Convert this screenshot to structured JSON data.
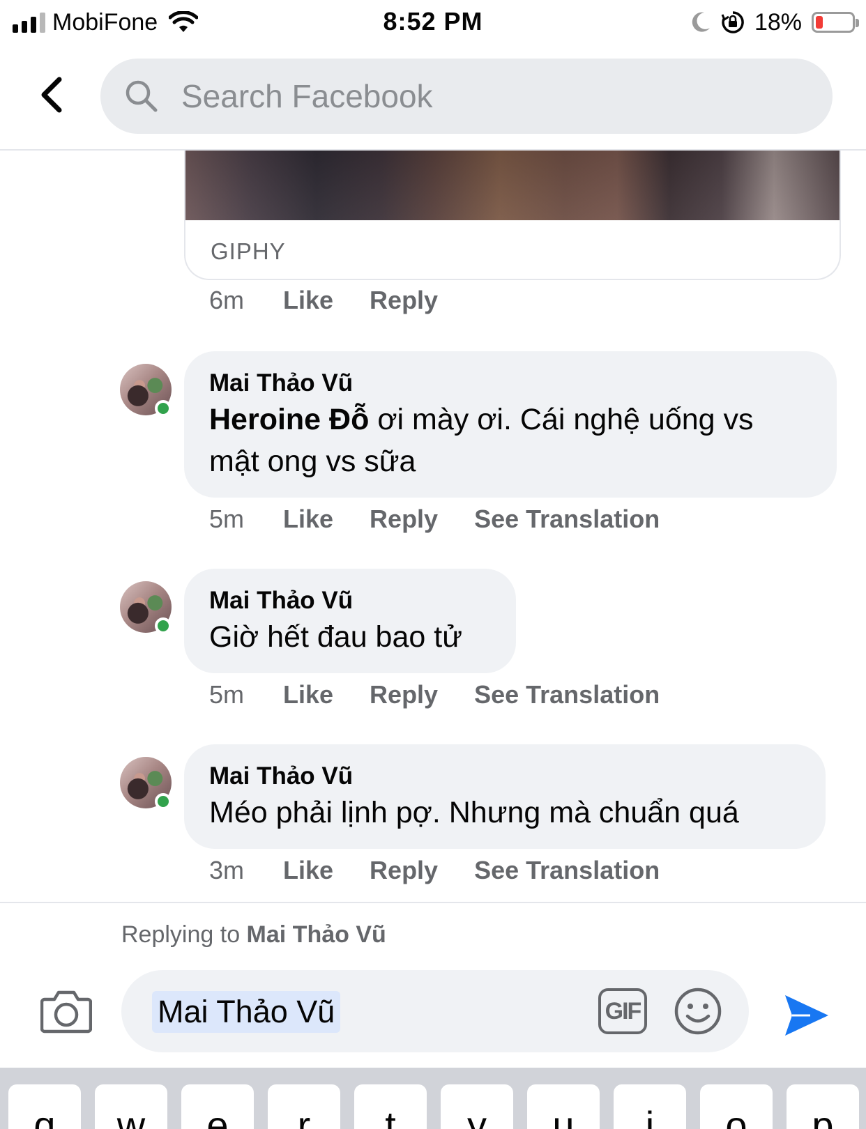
{
  "status_bar": {
    "carrier": "MobiFone",
    "time": "8:52 PM",
    "battery_percent": "18%",
    "battery_level": 0.18,
    "icons": [
      "signal-icon",
      "wifi-icon",
      "moon-icon",
      "orientation-lock-icon",
      "battery-icon"
    ]
  },
  "header": {
    "back_icon": "chevron-left-icon",
    "search_placeholder": "Search Facebook"
  },
  "gif_attachment": {
    "source": "GIPHY",
    "meta": {
      "time": "6m",
      "like": "Like",
      "reply": "Reply"
    }
  },
  "comments": [
    {
      "author": "Mai Thảo Vũ",
      "mention": "Heroine Đỗ",
      "text_line1": " ơi mày ơi. Cái nghệ uống vs",
      "text_line2": "mật ong vs sữa",
      "time": "5m",
      "like": "Like",
      "reply": "Reply",
      "translate": "See Translation"
    },
    {
      "author": "Mai Thảo Vũ",
      "text": "Giờ hết đau bao tử",
      "time": "5m",
      "like": "Like",
      "reply": "Reply",
      "translate": "See Translation"
    },
    {
      "author": "Mai Thảo Vũ",
      "text": "Méo phải lịnh pợ. Nhưng mà chuẩn quá",
      "time": "3m",
      "like": "Like",
      "reply": "Reply",
      "translate": "See Translation"
    }
  ],
  "composer": {
    "replying_prefix": "Replying to ",
    "replying_name": "Mai Thảo Vũ",
    "mention_tag": "Mai Thảo Vũ",
    "gif_label": "GIF",
    "accent_color": "#1877f2"
  },
  "keyboard": {
    "keys": [
      "q",
      "w",
      "e",
      "r",
      "t",
      "y",
      "u",
      "i",
      "o",
      "p"
    ]
  }
}
